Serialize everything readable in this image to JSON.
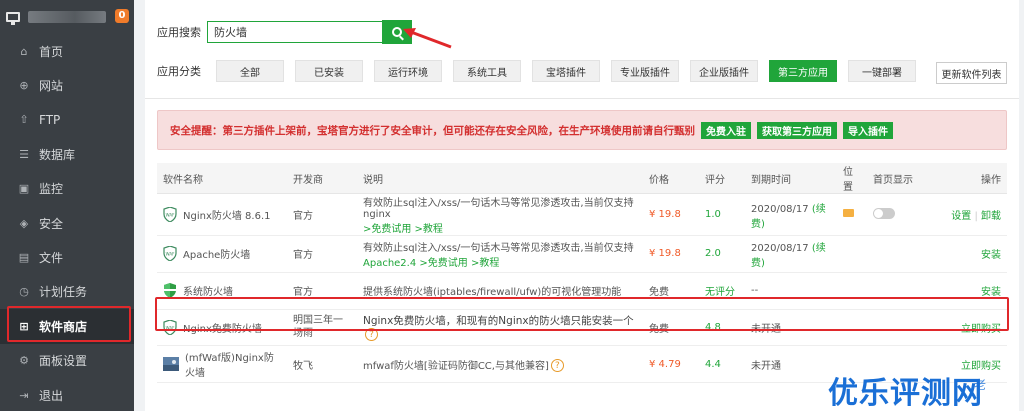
{
  "sidebar": {
    "badge": "0",
    "items": [
      {
        "icon": "⌂",
        "label": "首页"
      },
      {
        "icon": "⊕",
        "label": "网站"
      },
      {
        "icon": "⇧",
        "label": "FTP"
      },
      {
        "icon": "☰",
        "label": "数据库"
      },
      {
        "icon": "▣",
        "label": "监控"
      },
      {
        "icon": "◈",
        "label": "安全"
      },
      {
        "icon": "▤",
        "label": "文件"
      },
      {
        "icon": "◷",
        "label": "计划任务"
      },
      {
        "icon": "⊞",
        "label": "软件商店"
      },
      {
        "icon": "⚙",
        "label": "面板设置"
      },
      {
        "icon": "⇥",
        "label": "退出"
      }
    ]
  },
  "search": {
    "label": "应用搜索",
    "value": "防火墙"
  },
  "categories": {
    "label": "应用分类",
    "items": [
      "全部",
      "已安装",
      "运行环境",
      "系统工具",
      "宝塔插件",
      "专业版插件",
      "企业版插件",
      "第三方应用",
      "一键部署"
    ],
    "active": "第三方应用"
  },
  "update_button": "更新软件列表",
  "alert": {
    "text": "安全提醒：第三方插件上架前，宝塔官方进行了安全审计，但可能还存在安全风险，在生产环境使用前请自行甄别",
    "buttons": [
      "免费入驻",
      "获取第三方应用",
      "导入插件"
    ]
  },
  "table": {
    "headers": [
      "软件名称",
      "开发商",
      "说明",
      "价格",
      "评分",
      "到期时间",
      "位置",
      "首页显示",
      "操作"
    ],
    "rows": [
      {
        "name": "Nginx防火墙 8.6.1",
        "dev": "官方",
        "desc1": "有效防止sql注入/xss/一句话木马等常见渗透攻击,当前仅支持nginx",
        "desc2": ">免费试用 >教程",
        "price": "¥ 19.8",
        "score": "1.0",
        "expire": "2020/08/17",
        "renew": "(续费)",
        "ops": [
          "设置",
          "卸载"
        ]
      },
      {
        "name": "Apache防火墙",
        "dev": "官方",
        "desc1": "有效防止sql注入/xss/一句话木马等常见渗透攻击,当前仅支持",
        "desc2": "Apache2.4 >免费试用 >教程",
        "price": "¥ 19.8",
        "score": "2.0",
        "expire": "2020/08/17",
        "renew": "(续费)",
        "ops": [
          "安装"
        ]
      },
      {
        "name": "系统防火墙",
        "dev": "官方",
        "desc1": "提供系统防火墙(iptables/firewall/ufw)的可视化管理功能",
        "desc2": "",
        "price": "免费",
        "score": "无评分",
        "expire": "--",
        "renew": "",
        "ops": [
          "安装"
        ]
      },
      {
        "name": "Nginx免费防火墙",
        "dev": "明国三年一场雨",
        "desc1": "Nginx免费防火墙，和现有的Nginx的防火墙只能安装一个",
        "desc2": "",
        "price": "免费",
        "score": "4.8",
        "expire": "未开通",
        "renew": "",
        "ops": [
          "立即购买"
        ]
      },
      {
        "name": "(mfWaf版)Nginx防火墙",
        "dev": "牧飞",
        "desc1": "mfwaf防火墙[验证码防御CC,与其他兼容]",
        "desc2": "",
        "price": "¥ 4.79",
        "score": "4.4",
        "expire": "未开通",
        "renew": "",
        "ops": [
          "立即购买"
        ]
      }
    ]
  },
  "watermark": {
    "main": "优乐评测网",
    "small": "老"
  }
}
